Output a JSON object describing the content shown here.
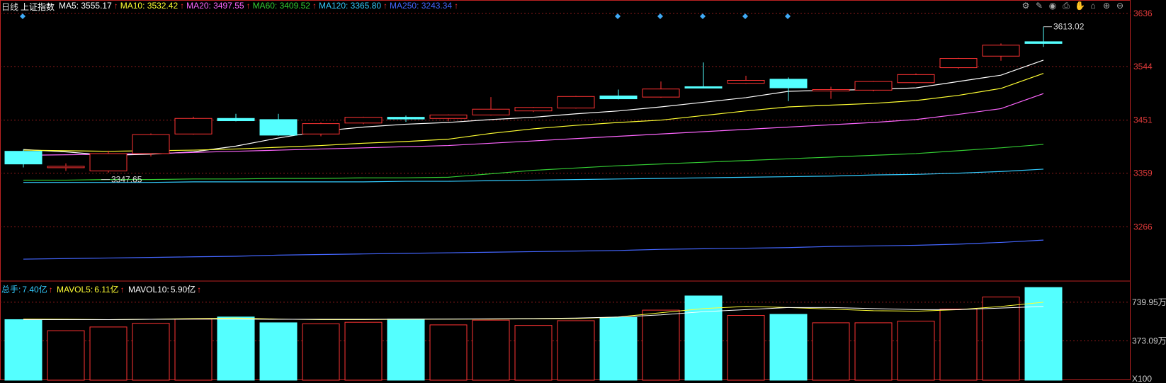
{
  "header": {
    "period": "日线",
    "name": "上证指数",
    "ma": [
      {
        "label": "MA5:",
        "value": "3555.17",
        "color": "#ffffff"
      },
      {
        "label": "MA10:",
        "value": "3532.42",
        "color": "#ffff33"
      },
      {
        "label": "MA20:",
        "value": "3497.55",
        "color": "#ff66ff"
      },
      {
        "label": "MA60:",
        "value": "3409.52",
        "color": "#33cc33"
      },
      {
        "label": "MA120:",
        "value": "3365.80",
        "color": "#33ccff"
      },
      {
        "label": "MA250:",
        "value": "3243.34",
        "color": "#4466ff"
      }
    ],
    "up_arrow": "↑"
  },
  "vol_header": {
    "total_label": "总手:",
    "total_value": "7.40亿",
    "mavol5_label": "MAVOL5:",
    "mavol5_value": "6.11亿",
    "mavol10_label": "MAVOL10:",
    "mavol10_value": "5.90亿"
  },
  "toolbar": [
    "settings-icon",
    "pen-icon",
    "eye-icon",
    "print-icon",
    "hand-icon",
    "lock-icon",
    "zoom-in-icon",
    "zoom-out-icon"
  ],
  "chart_data": {
    "type": "candlestick",
    "price_ticks": [
      "3636",
      "3544",
      "3451",
      "3359",
      "3266"
    ],
    "price_range": [
      3172,
      3636
    ],
    "high_annotation": "3613.02",
    "low_annotation": "3347.65",
    "colors": {
      "up": "#ff3333",
      "down": "#54ffff",
      "grid": "#8b1a1a"
    },
    "candles": [
      {
        "o": 3397,
        "c": 3375,
        "h": 3400,
        "l": 3369
      },
      {
        "o": 3371,
        "c": 3371,
        "h": 3376,
        "l": 3363
      },
      {
        "o": 3363,
        "c": 3393,
        "h": 3398,
        "l": 3360
      },
      {
        "o": 3393,
        "c": 3426,
        "h": 3428,
        "l": 3388
      },
      {
        "o": 3427,
        "c": 3454,
        "h": 3457,
        "l": 3426
      },
      {
        "o": 3454,
        "c": 3450,
        "h": 3462,
        "l": 3449
      },
      {
        "o": 3452,
        "c": 3425,
        "h": 3462,
        "l": 3424
      },
      {
        "o": 3427,
        "c": 3445,
        "h": 3447,
        "l": 3423
      },
      {
        "o": 3446,
        "c": 3456,
        "h": 3457,
        "l": 3444
      },
      {
        "o": 3456,
        "c": 3453,
        "h": 3459,
        "l": 3448
      },
      {
        "o": 3454,
        "c": 3460,
        "h": 3461,
        "l": 3449
      },
      {
        "o": 3460,
        "c": 3470,
        "h": 3491,
        "l": 3459
      },
      {
        "o": 3467,
        "c": 3473,
        "h": 3474,
        "l": 3465
      },
      {
        "o": 3472,
        "c": 3492,
        "h": 3493,
        "l": 3471
      },
      {
        "o": 3493,
        "c": 3488,
        "h": 3504,
        "l": 3487
      },
      {
        "o": 3491,
        "c": 3505,
        "h": 3518,
        "l": 3490
      },
      {
        "o": 3509,
        "c": 3508,
        "h": 3551,
        "l": 3506
      },
      {
        "o": 3515,
        "c": 3520,
        "h": 3528,
        "l": 3514
      },
      {
        "o": 3522,
        "c": 3507,
        "h": 3525,
        "l": 3484
      },
      {
        "o": 3503,
        "c": 3504,
        "h": 3509,
        "l": 3488
      },
      {
        "o": 3503,
        "c": 3518,
        "h": 3519,
        "l": 3501
      },
      {
        "o": 3516,
        "c": 3530,
        "h": 3532,
        "l": 3515
      },
      {
        "o": 3542,
        "c": 3558,
        "h": 3559,
        "l": 3540
      },
      {
        "o": 3562,
        "c": 3581,
        "h": 3584,
        "l": 3554
      },
      {
        "o": 3587,
        "c": 3584,
        "h": 3613,
        "l": 3578
      }
    ],
    "ma_lines": [
      {
        "name": "MA5",
        "color": "#ffffff",
        "values": [
          3400,
          3396,
          3390,
          3392,
          3396,
          3406,
          3420,
          3432,
          3439,
          3444,
          3447,
          3452,
          3456,
          3462,
          3467,
          3474,
          3482,
          3490,
          3501,
          3503,
          3504,
          3507,
          3518,
          3529,
          3555
        ]
      },
      {
        "name": "MA10",
        "color": "#ffff33",
        "values": [
          3399,
          3398,
          3397,
          3398,
          3399,
          3401,
          3404,
          3407,
          3411,
          3414,
          3418,
          3428,
          3436,
          3442,
          3447,
          3451,
          3459,
          3467,
          3474,
          3477,
          3480,
          3485,
          3494,
          3506,
          3532
        ]
      },
      {
        "name": "MA20",
        "color": "#ff66ff",
        "values": [
          3390,
          3391,
          3392,
          3393,
          3395,
          3397,
          3399,
          3401,
          3403,
          3405,
          3407,
          3411,
          3415,
          3419,
          3423,
          3427,
          3431,
          3435,
          3439,
          3443,
          3447,
          3452,
          3461,
          3471,
          3497
        ]
      },
      {
        "name": "MA60",
        "color": "#33cc33",
        "values": [
          3347,
          3347,
          3348,
          3348,
          3349,
          3349,
          3350,
          3350,
          3351,
          3351,
          3352,
          3358,
          3364,
          3368,
          3372,
          3375,
          3378,
          3381,
          3384,
          3387,
          3390,
          3393,
          3398,
          3403,
          3409
        ]
      },
      {
        "name": "MA120",
        "color": "#33ccff",
        "values": [
          3343,
          3343,
          3343,
          3343,
          3344,
          3344,
          3344,
          3344,
          3344,
          3345,
          3345,
          3346,
          3347,
          3348,
          3349,
          3350,
          3351,
          3352,
          3353,
          3354,
          3356,
          3357,
          3359,
          3362,
          3366
        ]
      },
      {
        "name": "MA250",
        "color": "#4466ff",
        "values": [
          3210,
          3211,
          3212,
          3213,
          3214,
          3215,
          3217,
          3218,
          3219,
          3220,
          3221,
          3222,
          3223,
          3224,
          3225,
          3227,
          3228,
          3229,
          3230,
          3232,
          3233,
          3234,
          3236,
          3239,
          3243
        ]
      }
    ],
    "volume_ticks": [
      "739.95万",
      "373.09万",
      "X100"
    ],
    "volume_range": [
      0,
      800
    ],
    "volumes": [
      575,
      470,
      505,
      540,
      580,
      600,
      545,
      535,
      550,
      580,
      525,
      570,
      520,
      565,
      595,
      665,
      800,
      615,
      625,
      545,
      545,
      560,
      675,
      790,
      880
    ],
    "mavol5": [
      580,
      578,
      575,
      578,
      585,
      590,
      580,
      575,
      575,
      578,
      580,
      580,
      582,
      585,
      600,
      640,
      680,
      700,
      690,
      675,
      660,
      655,
      670,
      700,
      740
    ],
    "mavol10": [
      575,
      575,
      575,
      578,
      580,
      580,
      578,
      578,
      578,
      580,
      580,
      582,
      585,
      590,
      600,
      620,
      650,
      670,
      690,
      690,
      680,
      670,
      670,
      685,
      700
    ],
    "event_markers": [
      0,
      14,
      15,
      16,
      17,
      18
    ]
  }
}
